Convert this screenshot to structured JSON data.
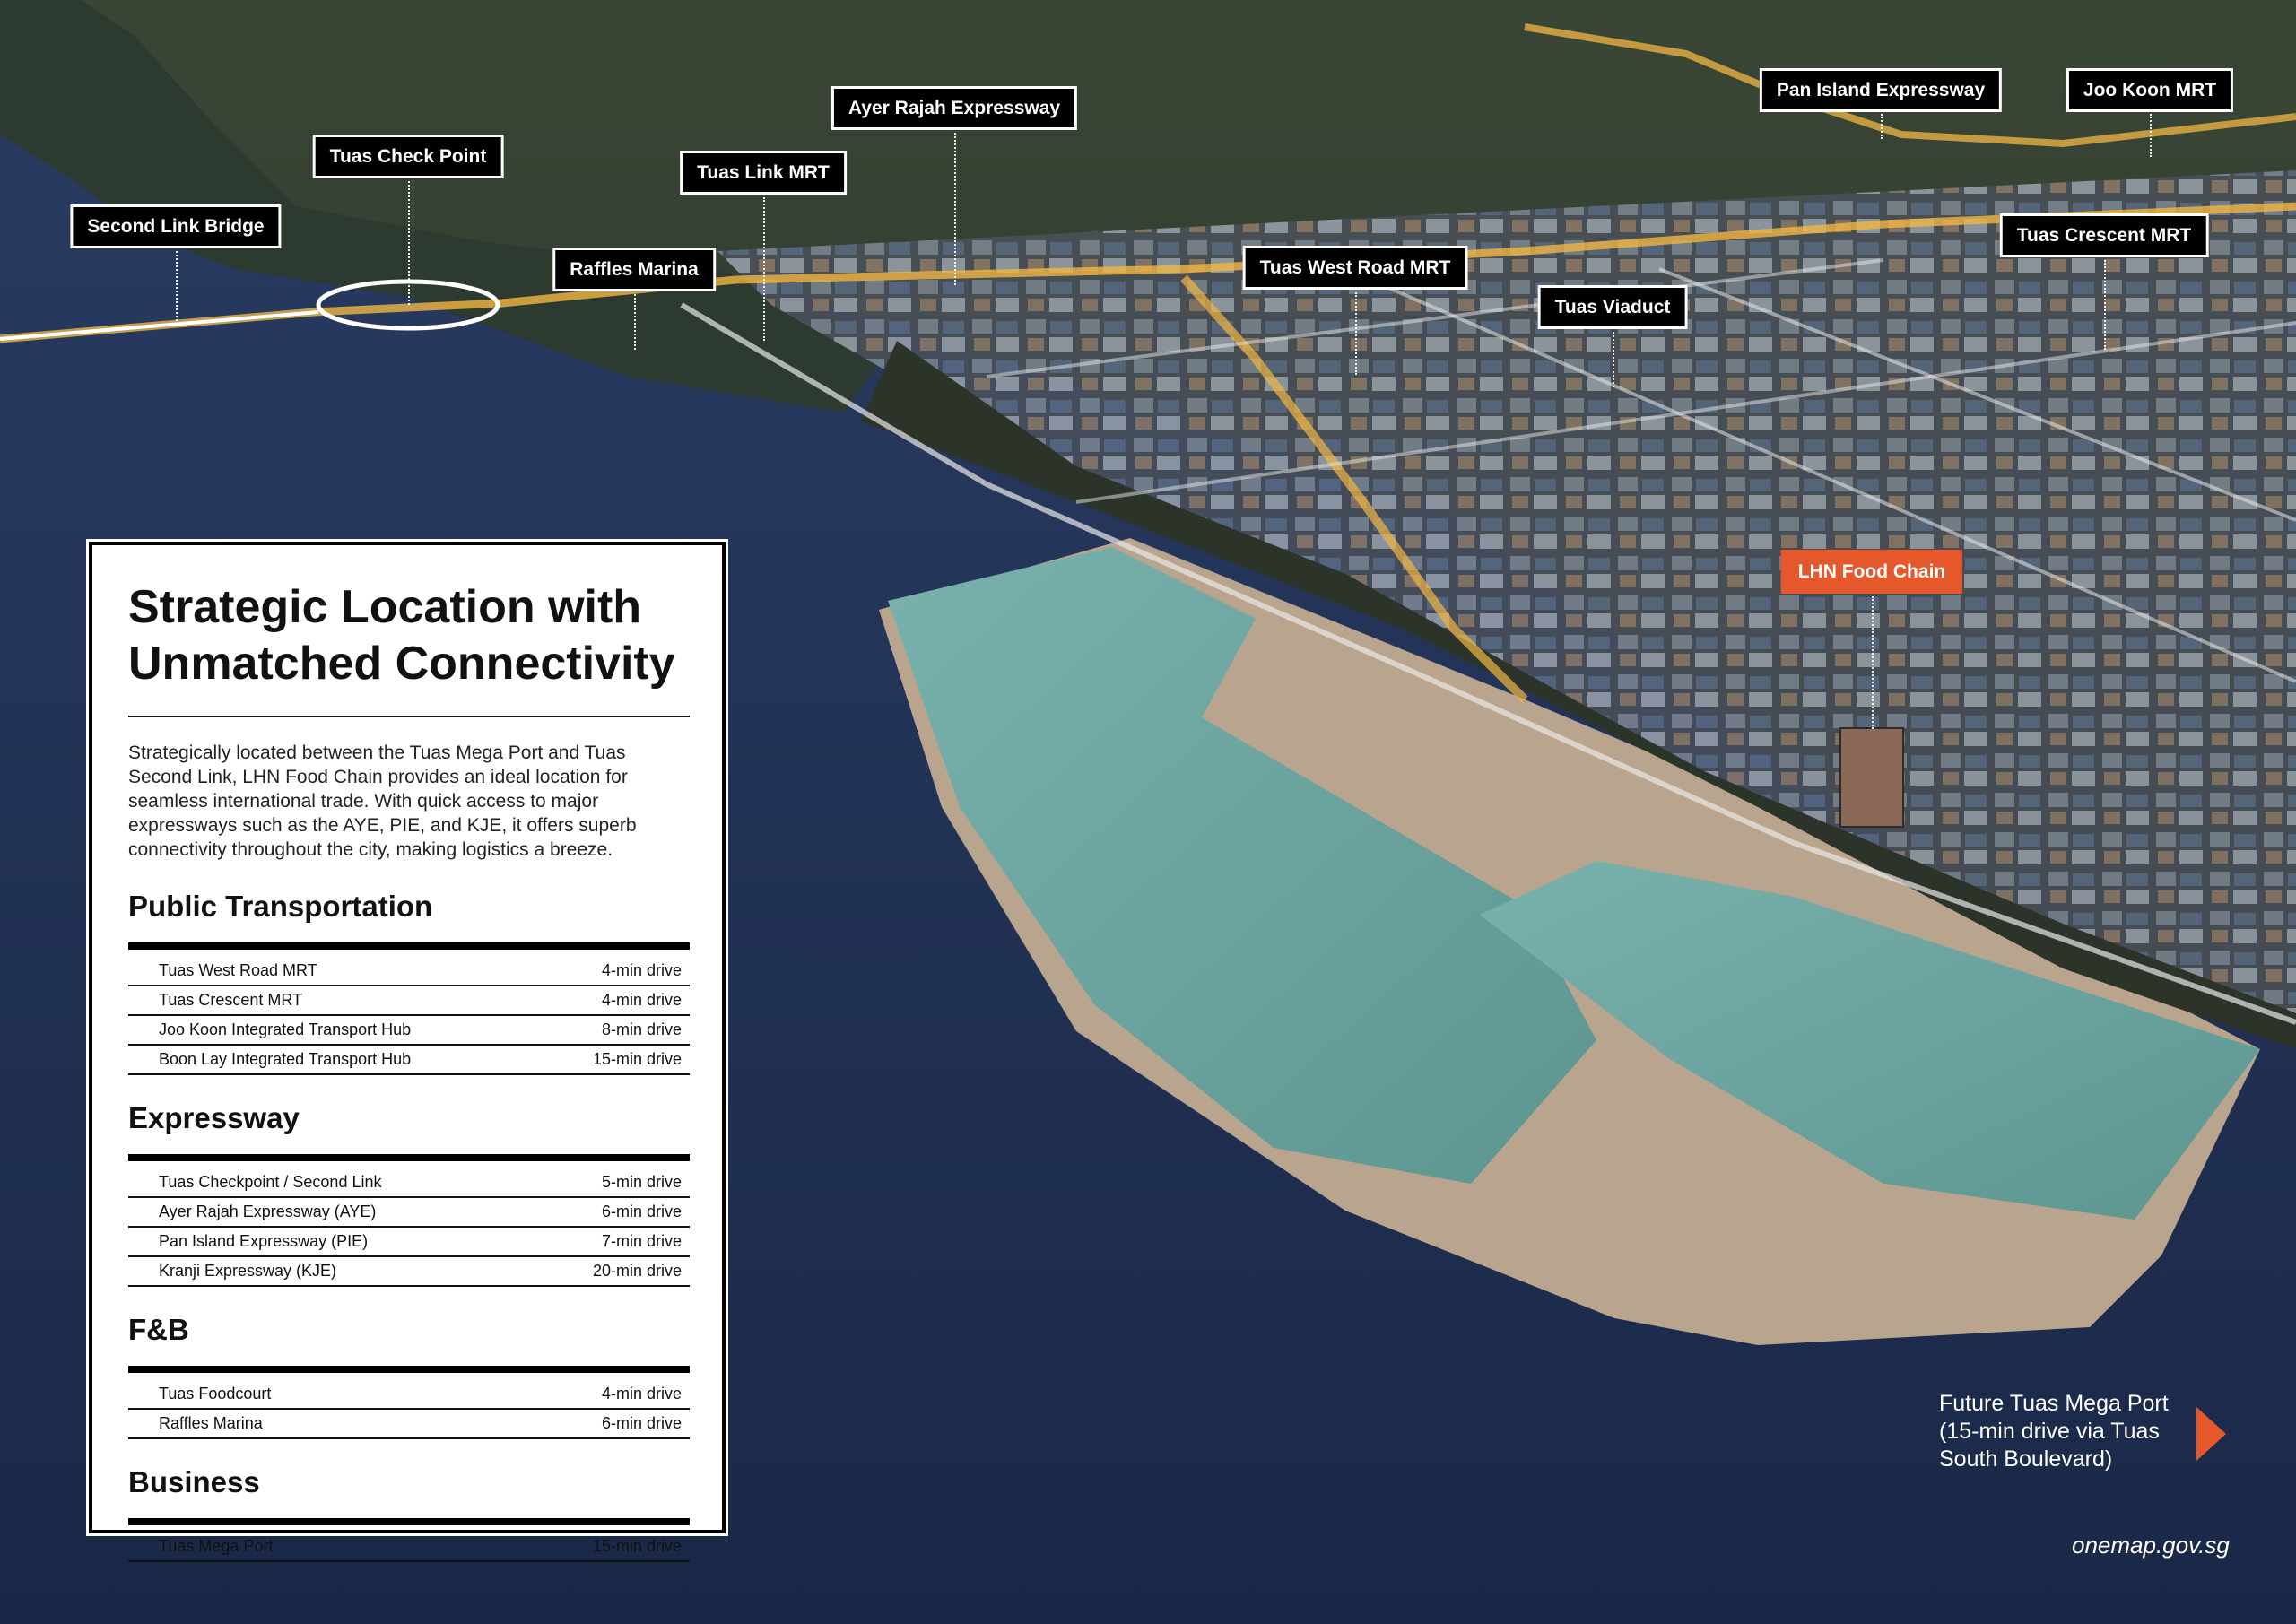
{
  "colors": {
    "accent": "#e4582c",
    "sea": "#1f2d4a",
    "lagoon": "#6fa7a4",
    "land": "#2f3b2c",
    "road": "#f1b744"
  },
  "map_labels": [
    {
      "id": "second-link-bridge",
      "text": "Second Link Bridge"
    },
    {
      "id": "tuas-check-point",
      "text": "Tuas Check Point"
    },
    {
      "id": "raffles-marina",
      "text": "Raffles Marina"
    },
    {
      "id": "tuas-link-mrt",
      "text": "Tuas Link MRT"
    },
    {
      "id": "ayer-rajah-expressway",
      "text": "Ayer Rajah Expressway"
    },
    {
      "id": "tuas-west-road-mrt",
      "text": "Tuas West Road MRT"
    },
    {
      "id": "tuas-viaduct",
      "text": "Tuas Viaduct"
    },
    {
      "id": "pan-island-expressway",
      "text": "Pan Island Expressway"
    },
    {
      "id": "joo-koon-mrt",
      "text": "Joo Koon MRT"
    },
    {
      "id": "tuas-crescent-mrt",
      "text": "Tuas Crescent MRT"
    },
    {
      "id": "lhn-food-chain",
      "text": "LHN Food Chain",
      "highlight": true
    }
  ],
  "panel": {
    "title_line1": "Strategic Location with",
    "title_line2": "Unmatched Connectivity",
    "body": "Strategically located between the Tuas Mega Port and Tuas Second Link, LHN Food Chain provides an ideal location for seamless international trade. With quick access to major expressways such as the AYE, PIE, and KJE, it offers superb connectivity throughout the city, making logistics a breeze.",
    "sections": [
      {
        "heading": "Public Transportation",
        "rows": [
          {
            "place": "Tuas West Road MRT",
            "time": "4-min drive"
          },
          {
            "place": "Tuas Crescent MRT",
            "time": "4-min drive"
          },
          {
            "place": "Joo Koon Integrated Transport Hub",
            "time": "8-min drive"
          },
          {
            "place": "Boon Lay Integrated Transport Hub",
            "time": "15-min drive"
          }
        ]
      },
      {
        "heading": "Expressway",
        "rows": [
          {
            "place": "Tuas Checkpoint / Second Link",
            "time": "5-min drive"
          },
          {
            "place": "Ayer Rajah Expressway (AYE)",
            "time": "6-min drive"
          },
          {
            "place": "Pan Island Expressway (PIE)",
            "time": "7-min drive"
          },
          {
            "place": "Kranji Expressway (KJE)",
            "time": "20-min drive"
          }
        ]
      },
      {
        "heading": "F&B",
        "rows": [
          {
            "place": "Tuas Foodcourt",
            "time": "4-min drive"
          },
          {
            "place": "Raffles Marina",
            "time": "6-min drive"
          }
        ]
      },
      {
        "heading": "Business",
        "rows": [
          {
            "place": "Tuas Mega Port",
            "time": "15-min drive"
          }
        ]
      }
    ]
  },
  "port_note": {
    "line1": "Future Tuas Mega Port",
    "line2": "(15-min drive via Tuas",
    "line3": "South Boulevard)",
    "icon": "triangle-arrow-right-icon"
  },
  "source": "onemap.gov.sg"
}
